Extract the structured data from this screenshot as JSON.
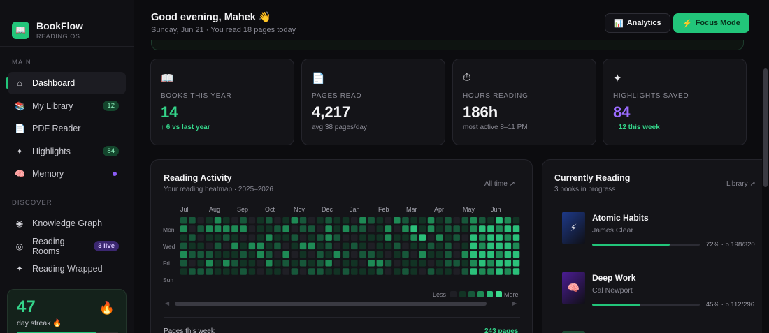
{
  "app": {
    "name": "BookFlow",
    "subtitle": "READING OS",
    "logo_icon": "book-icon"
  },
  "sidebar": {
    "main_label": "MAIN",
    "main_items": [
      {
        "label": "Dashboard",
        "icon": "home-icon",
        "active": true
      },
      {
        "label": "My Library",
        "icon": "books-icon",
        "badge": "12"
      },
      {
        "label": "PDF Reader",
        "icon": "document-icon"
      },
      {
        "label": "Highlights",
        "icon": "sparkle-icon",
        "badge": "84"
      },
      {
        "label": "Memory",
        "icon": "brain-icon",
        "dot": "#8b5cf6"
      }
    ],
    "discover_label": "DISCOVER",
    "discover_items": [
      {
        "label": "Knowledge Graph",
        "icon": "graph-icon"
      },
      {
        "label": "Reading Rooms",
        "icon": "radio-icon",
        "badge": "3 live"
      },
      {
        "label": "Reading Wrapped",
        "icon": "sparkle-icon"
      }
    ],
    "streak": {
      "value": "47",
      "label": "day streak 🔥",
      "progress": 0.78
    }
  },
  "header": {
    "greeting": "Good evening, Mahek 👋",
    "subline": "Sunday, Jun 21 · You read 18 pages today",
    "analytics_label": "Analytics",
    "focus_label": "Focus Mode"
  },
  "stats": [
    {
      "icon": "📖",
      "label": "BOOKS THIS YEAR",
      "value": "14",
      "sub": "↑ 6 vs last year"
    },
    {
      "icon": "📄",
      "label": "PAGES READ",
      "value": "4,217",
      "sub": "avg 38 pages/day"
    },
    {
      "icon": "⏱",
      "label": "HOURS READING",
      "value": "186h",
      "sub": "most active 8–11 PM"
    },
    {
      "icon": "✦",
      "label": "HIGHLIGHTS SAVED",
      "value": "84",
      "sub": "↑ 12 this week"
    }
  ],
  "activity": {
    "title": "Reading Activity",
    "subtitle": "Your reading heatmap · 2025–2026",
    "link": "All time ↗",
    "months": [
      "Jul",
      "Aug",
      "Sep",
      "Oct",
      "Nov",
      "Dec",
      "Jan",
      "Feb",
      "Mar",
      "Apr",
      "May",
      "Jun"
    ],
    "days": [
      "Mon",
      "Wed",
      "Fri",
      "Sun"
    ],
    "legend_less": "Less",
    "legend_more": "More",
    "levels_colors": [
      "#1f1f25",
      "#123324",
      "#17573a",
      "#1e8a55",
      "#2bc07a",
      "#3ddc8f"
    ],
    "heatmap": [
      [
        2,
        2,
        0,
        1,
        3,
        1,
        0,
        2,
        0,
        1,
        2,
        0,
        1,
        3,
        2,
        0,
        1,
        2,
        1,
        1,
        0,
        3,
        2,
        1,
        0,
        3,
        2,
        1,
        1,
        3,
        1,
        2,
        0,
        2,
        3,
        2,
        1,
        4,
        3,
        1
      ],
      [
        3,
        0,
        2,
        3,
        3,
        3,
        3,
        3,
        0,
        1,
        1,
        2,
        3,
        0,
        2,
        2,
        0,
        3,
        1,
        3,
        2,
        2,
        0,
        1,
        3,
        0,
        3,
        4,
        1,
        3,
        1,
        2,
        2,
        1,
        3,
        4,
        4,
        3,
        4,
        4
      ],
      [
        1,
        2,
        0,
        1,
        1,
        2,
        1,
        0,
        0,
        1,
        3,
        1,
        1,
        2,
        0,
        1,
        2,
        3,
        2,
        0,
        0,
        1,
        1,
        1,
        3,
        1,
        1,
        3,
        4,
        0,
        3,
        1,
        2,
        0,
        4,
        3,
        4,
        4,
        3,
        4
      ],
      [
        2,
        1,
        1,
        0,
        2,
        0,
        3,
        1,
        3,
        3,
        1,
        2,
        0,
        1,
        3,
        3,
        1,
        2,
        0,
        1,
        2,
        1,
        0,
        1,
        1,
        2,
        0,
        1,
        1,
        2,
        1,
        2,
        0,
        1,
        4,
        3,
        4,
        4,
        4,
        3
      ],
      [
        3,
        2,
        2,
        2,
        1,
        1,
        1,
        2,
        1,
        3,
        2,
        0,
        3,
        0,
        1,
        0,
        2,
        1,
        3,
        2,
        0,
        2,
        2,
        1,
        0,
        1,
        2,
        0,
        3,
        1,
        1,
        2,
        0,
        3,
        4,
        4,
        4,
        3,
        4,
        4
      ],
      [
        2,
        0,
        1,
        3,
        1,
        3,
        2,
        1,
        1,
        0,
        3,
        1,
        2,
        1,
        2,
        1,
        2,
        3,
        0,
        1,
        1,
        0,
        3,
        3,
        2,
        0,
        1,
        1,
        1,
        0,
        1,
        2,
        2,
        1,
        3,
        4,
        3,
        4,
        4,
        4
      ],
      [
        1,
        2,
        2,
        2,
        1,
        1,
        1,
        2,
        1,
        0,
        1,
        1,
        0,
        2,
        0,
        2,
        2,
        1,
        1,
        2,
        1,
        1,
        1,
        2,
        0,
        1,
        2,
        1,
        0,
        2,
        1,
        1,
        0,
        2,
        4,
        3,
        3,
        4,
        3,
        4
      ]
    ],
    "pages_label": "Pages this week",
    "pages_value": "243 pages"
  },
  "current": {
    "title": "Currently Reading",
    "subtitle": "3 books in progress",
    "link": "Library ↗",
    "books": [
      {
        "title": "Atomic Habits",
        "author": "James Clear",
        "progress": 0.72,
        "meta": "72% · p.198/320",
        "cover_color": "#1e3a8a",
        "cover_icon": "⚡"
      },
      {
        "title": "Deep Work",
        "author": "Cal Newport",
        "progress": 0.45,
        "meta": "45% · p.112/296",
        "cover_color": "#4c1d95",
        "cover_icon": "🧠"
      }
    ]
  }
}
